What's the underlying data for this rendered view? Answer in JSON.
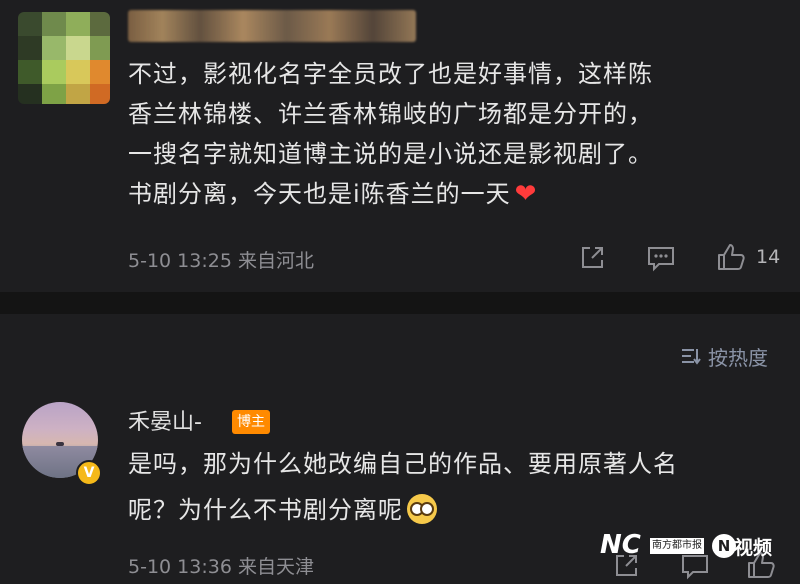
{
  "comment1": {
    "lines": [
      "不过，影视化名字全员改了也是好事情，这样陈",
      "香兰林锦楼、许兰香林锦岐的广场都是分开的，",
      "一搜名字就知道博主说的是小说还是影视剧了。",
      "书剧分离，今天也是i陈香兰的一天"
    ],
    "emoji": "❤",
    "meta": "5-10 13:25 来自河北",
    "icons": [
      "share-icon",
      "comment-icon",
      "like-icon"
    ],
    "likes": "14"
  },
  "sort": {
    "icon": "sort-icon",
    "label": "按热度"
  },
  "comment2": {
    "author": "禾晏山-",
    "badge": "博主",
    "verified_badge": "V",
    "lines": [
      "是吗，那为什么她改编自己的作品、要用原著人名",
      "呢？为什么不书剧分离呢"
    ],
    "emoji": "glasses-face-emoji",
    "meta": "5-10 13:36 来自天津",
    "icons": [
      "share-icon",
      "comment-icon",
      "like-icon"
    ]
  },
  "watermark": {
    "nc": "NC",
    "paper": "南方都市报",
    "n_logo": "N",
    "video": "视频"
  },
  "colors": {
    "background": "#1e1e20",
    "text": "#e6e6e6",
    "meta": "#8e8e93",
    "heart": "#ff3b3b",
    "host_badge": "#ff8a00",
    "verified": "#f5b919"
  }
}
